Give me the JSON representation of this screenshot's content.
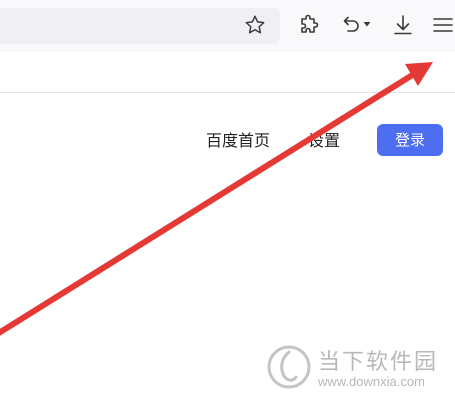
{
  "toolbar": {
    "icons": [
      "star-icon",
      "extensions-icon",
      "undo-icon",
      "download-icon",
      "menu-icon"
    ]
  },
  "nav": {
    "home_label": "百度首页",
    "settings_label": "设置",
    "login_label": "登录"
  },
  "annotation": {
    "arrow_color": "#e53935",
    "points_to": "menu-icon"
  },
  "watermark": {
    "title": "当下软件园",
    "url": "www.downxia.com"
  },
  "colors": {
    "login_button": "#4e6ef2",
    "toolbar_bg": "#f9f9fb",
    "urlbar_bg": "#f0f0f4"
  }
}
